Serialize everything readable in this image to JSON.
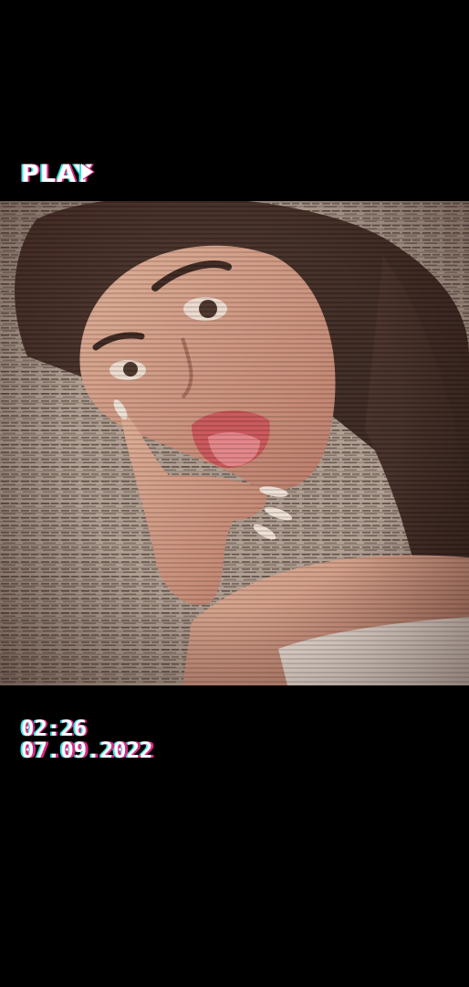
{
  "overlay": {
    "play_label": "PLAY",
    "play_icon": "play-triangle-icon",
    "time": "02:26",
    "date": "07.09.2022"
  },
  "colors": {
    "background": "#000000",
    "glitch_magenta": "#d62a84",
    "glitch_cyan": "#3cdfe6"
  }
}
